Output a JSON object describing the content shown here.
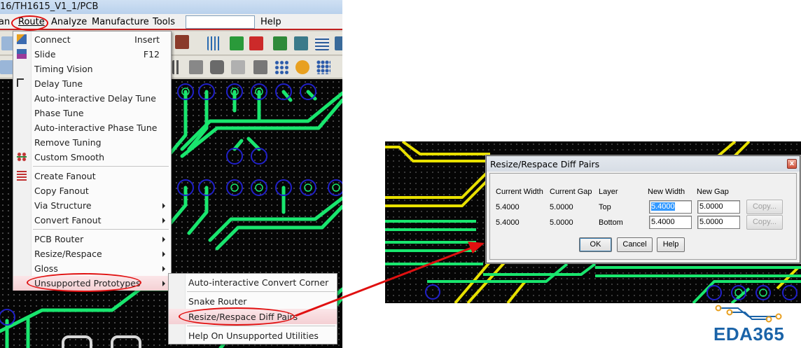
{
  "window": {
    "title": "16/TH1615_V1_1/PCB"
  },
  "menubar": {
    "items": [
      "an",
      "Route",
      "Analyze",
      "Manufacture",
      "Tools",
      "Help"
    ]
  },
  "route_menu": {
    "items": [
      {
        "label": "Connect",
        "shortcut": "Insert",
        "icon": "connect-icon"
      },
      {
        "label": "Slide",
        "shortcut": "F12",
        "icon": "slide-icon"
      },
      {
        "label": "Timing Vision"
      },
      {
        "label": "Delay Tune",
        "icon": "delay-tune-icon"
      },
      {
        "label": "Auto-interactive Delay Tune"
      },
      {
        "label": "Phase Tune"
      },
      {
        "label": "Auto-interactive Phase Tune"
      },
      {
        "label": "Remove Tuning"
      },
      {
        "label": "Custom Smooth",
        "icon": "smooth-icon"
      },
      {
        "label": "Create Fanout",
        "icon": "fanout-icon"
      },
      {
        "label": "Copy Fanout"
      },
      {
        "label": "Via Structure",
        "submenu": true
      },
      {
        "label": "Convert Fanout",
        "submenu": true
      },
      {
        "label": "PCB Router",
        "submenu": true
      },
      {
        "label": "Resize/Respace",
        "submenu": true
      },
      {
        "label": "Gloss",
        "submenu": true
      },
      {
        "label": "Unsupported Prototypes",
        "submenu": true
      }
    ]
  },
  "submenu": {
    "items": [
      {
        "label": "Auto-interactive Convert Corner"
      },
      {
        "label": "Snake Router"
      },
      {
        "label": "Resize/Respace Diff Pairs"
      },
      {
        "label": "Help On Unsupported Utilities"
      }
    ]
  },
  "dialog": {
    "title": "Resize/Respace Diff Pairs",
    "close_label": "x",
    "headers": [
      "Current Width",
      "Current Gap",
      "Layer",
      "New Width",
      "New Gap"
    ],
    "rows": [
      {
        "current_width": "5.4000",
        "current_gap": "5.0000",
        "layer": "Top",
        "new_width": "5.4000",
        "new_gap": "5.0000",
        "copy": "Copy..."
      },
      {
        "current_width": "5.4000",
        "current_gap": "5.0000",
        "layer": "Bottom",
        "new_width": "5.4000",
        "new_gap": "5.0000",
        "copy": "Copy..."
      }
    ],
    "ok_label": "OK",
    "cancel_label": "Cancel",
    "help_label": "Help"
  },
  "logo": {
    "text": "EDA365"
  },
  "colors": {
    "annotation_red": "#e01010",
    "trace_green": "#19e66e",
    "trace_yellow": "#e8e000",
    "via_blue": "#2020c8",
    "logo_blue": "#1a63a8",
    "logo_orange": "#e8a020"
  }
}
